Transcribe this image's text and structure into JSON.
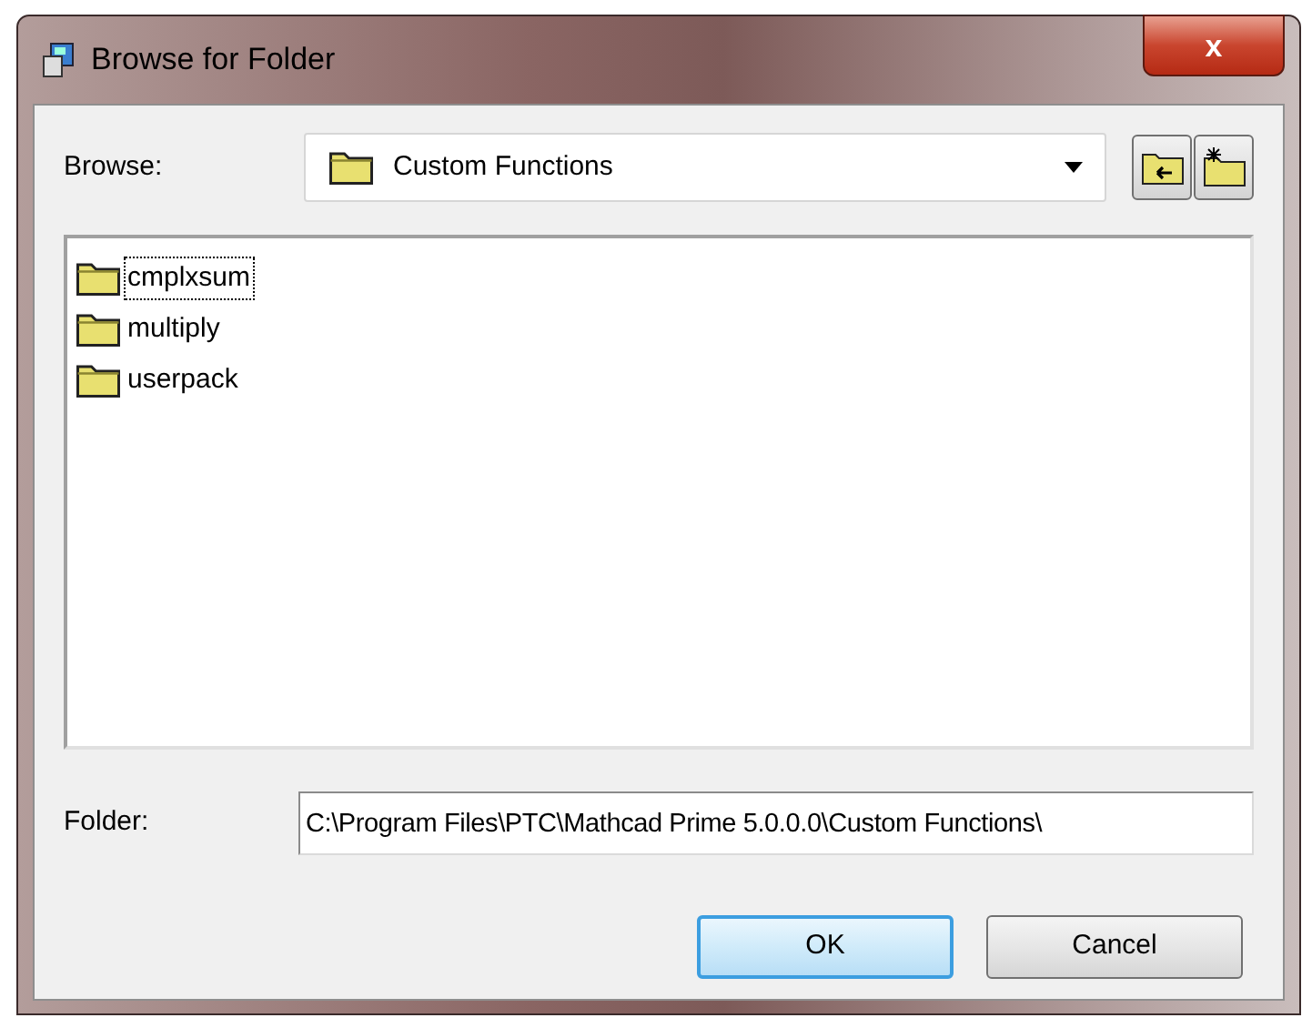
{
  "window": {
    "title": "Browse for Folder",
    "close": "x"
  },
  "browse": {
    "label": "Browse:",
    "value": "Custom Functions"
  },
  "folders": [
    {
      "name": "cmplxsum",
      "selected": true
    },
    {
      "name": "multiply",
      "selected": false
    },
    {
      "name": "userpack",
      "selected": false
    }
  ],
  "folder_field": {
    "label": "Folder:",
    "value": "C:\\Program Files\\PTC\\Mathcad Prime 5.0.0.0\\Custom Functions\\"
  },
  "buttons": [
    {
      "label": "OK",
      "kind": "default"
    },
    {
      "label": "Cancel",
      "kind": "normal"
    }
  ]
}
